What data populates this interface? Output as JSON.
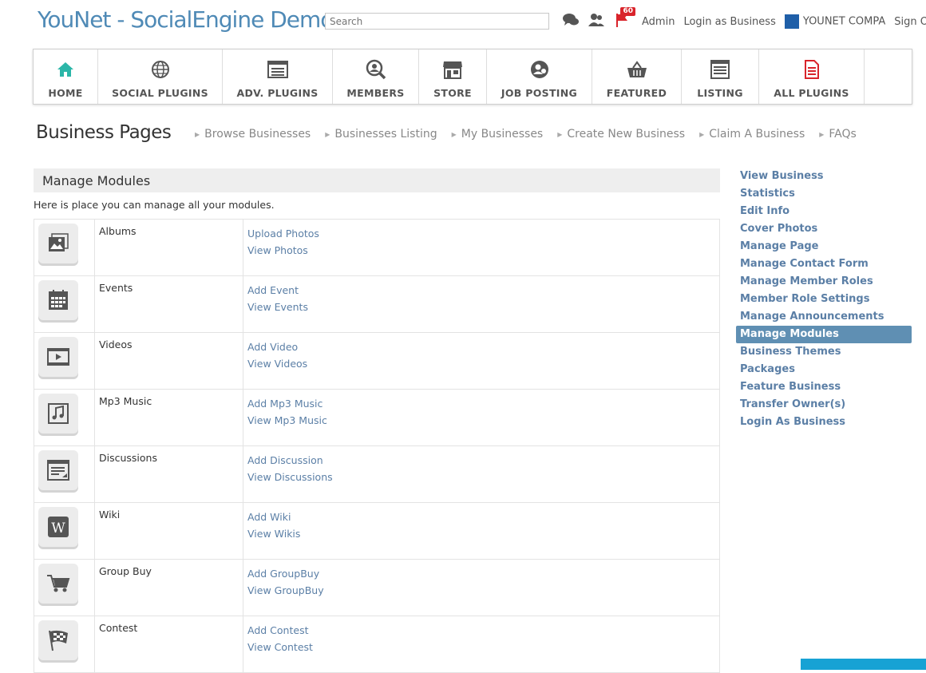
{
  "header": {
    "site_title": "YouNet - SocialEngine Demo",
    "search_placeholder": "Search",
    "notification_count": "60",
    "links": [
      "Admin",
      "Login as Business",
      "YOUNET COMPA",
      "Sign Out"
    ]
  },
  "nav": [
    {
      "label": "HOME",
      "icon": "home-icon",
      "color": "#2bb6a8"
    },
    {
      "label": "SOCIAL PLUGINS",
      "icon": "globe-icon",
      "color": "#555"
    },
    {
      "label": "ADV. PLUGINS",
      "icon": "window-icon",
      "color": "#555"
    },
    {
      "label": "MEMBERS",
      "icon": "members-search-icon",
      "color": "#555"
    },
    {
      "label": "STORE",
      "icon": "store-icon",
      "color": "#555"
    },
    {
      "label": "JOB POSTING",
      "icon": "job-icon",
      "color": "#555"
    },
    {
      "label": "FEATURED",
      "icon": "basket-icon",
      "color": "#555"
    },
    {
      "label": "LISTING",
      "icon": "listing-icon",
      "color": "#555"
    },
    {
      "label": "ALL PLUGINS",
      "icon": "document-icon",
      "color": "#d9242b"
    }
  ],
  "page": {
    "title": "Business Pages",
    "subnav": [
      "Browse Businesses",
      "Businesses Listing",
      "My Businesses",
      "Create New Business",
      "Claim A Business",
      "FAQs"
    ]
  },
  "panel": {
    "title": "Manage Modules",
    "description": "Here is place you can manage all your modules."
  },
  "modules": [
    {
      "name": "Albums",
      "icon": "albums-icon",
      "links": [
        "Upload Photos",
        "View Photos"
      ]
    },
    {
      "name": "Events",
      "icon": "calendar-icon",
      "links": [
        "Add Event",
        "View Events"
      ]
    },
    {
      "name": "Videos",
      "icon": "video-icon",
      "links": [
        "Add Video",
        "View Videos"
      ]
    },
    {
      "name": "Mp3 Music",
      "icon": "music-icon",
      "links": [
        "Add Mp3 Music",
        "View Mp3 Music"
      ]
    },
    {
      "name": "Discussions",
      "icon": "discussion-icon",
      "links": [
        "Add Discussion",
        "View Discussions"
      ]
    },
    {
      "name": "Wiki",
      "icon": "wiki-icon",
      "links": [
        "Add Wiki",
        "View Wikis"
      ]
    },
    {
      "name": "Group Buy",
      "icon": "cart-icon",
      "links": [
        "Add GroupBuy",
        "View GroupBuy"
      ]
    },
    {
      "name": "Contest",
      "icon": "flag-icon",
      "links": [
        "Add Contest",
        "View Contest"
      ]
    }
  ],
  "sidebar": {
    "active": "Manage Modules",
    "items": [
      "View Business",
      "Statistics",
      "Edit Info",
      "Cover Photos",
      "Manage Page",
      "Manage Contact Form",
      "Manage Member Roles",
      "Member Role Settings",
      "Manage Announcements",
      "Manage Modules",
      "Business Themes",
      "Packages",
      "Feature Business",
      "Transfer Owner(s)",
      "Login As Business"
    ]
  },
  "colors": {
    "link": "#5b7fa6",
    "active_bg": "#5f8fb3",
    "title": "#4f8ab6"
  }
}
